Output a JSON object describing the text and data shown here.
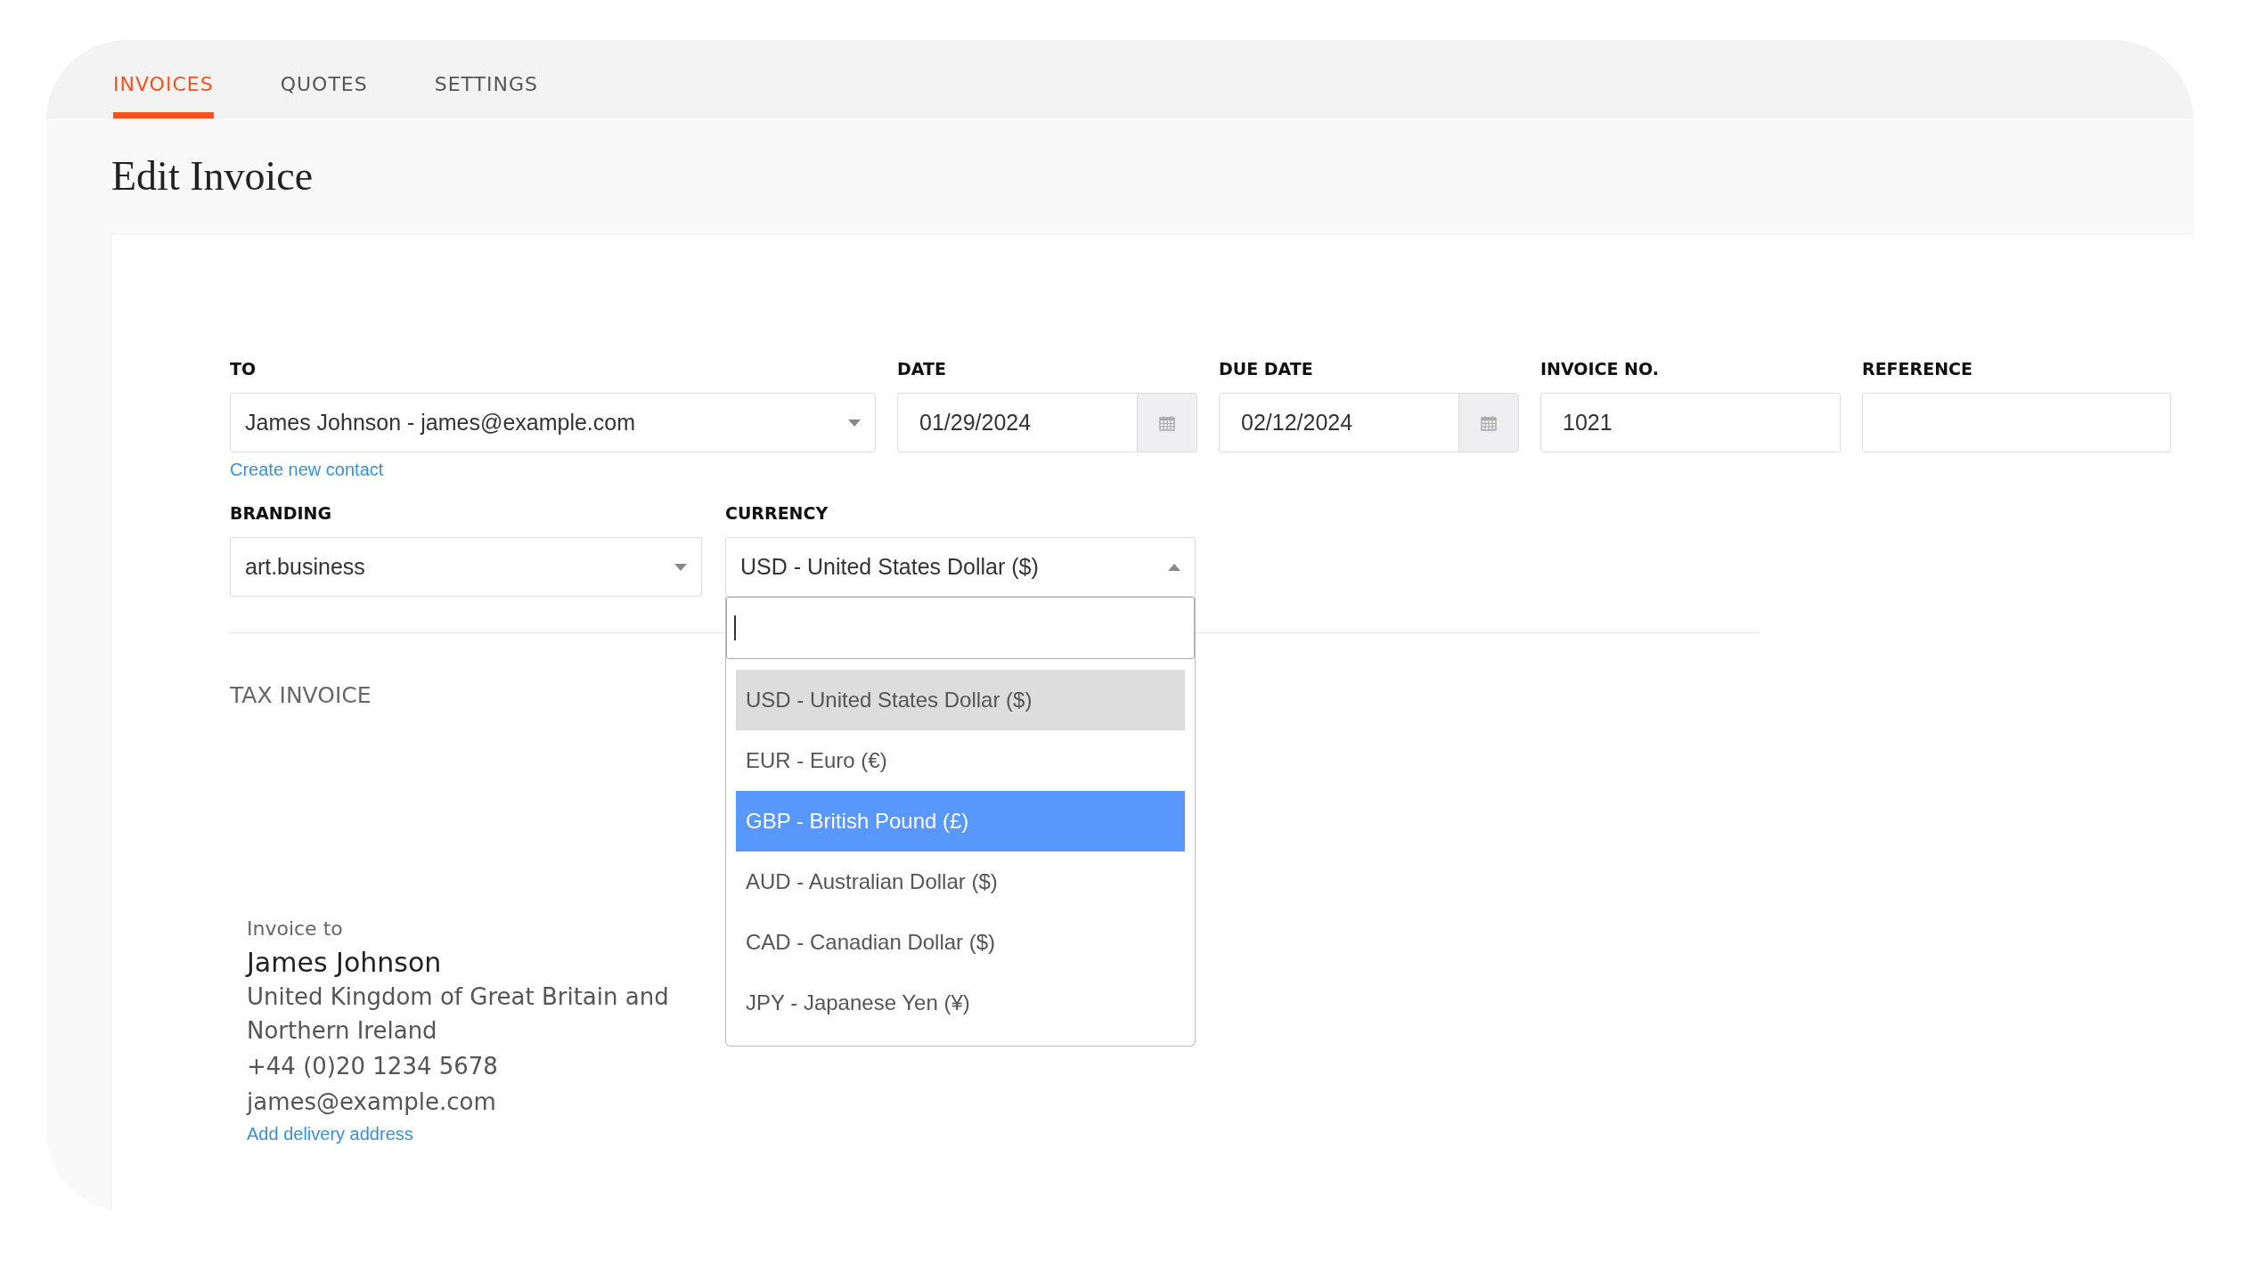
{
  "tabs": [
    {
      "label": "INVOICES",
      "selected": true
    },
    {
      "label": "QUOTES",
      "selected": false
    },
    {
      "label": "SETTINGS",
      "selected": false
    }
  ],
  "page_title": "Edit Invoice",
  "form": {
    "row_1": [
      {
        "kind": "select",
        "label": "TO",
        "value": "James Johnson - james@example.com",
        "link": "Create new contact",
        "expanded": false
      },
      {
        "kind": "date",
        "label": "DATE",
        "value": "01/29/2024"
      },
      {
        "kind": "date",
        "label": "DUE DATE",
        "value": "02/12/2024"
      },
      {
        "kind": "text",
        "label": "INVOICE NO.",
        "value": "1021"
      },
      {
        "kind": "text",
        "label": "REFERENCE"
      }
    ],
    "row_2": [
      {
        "kind": "select",
        "label": "BRANDING",
        "value": "art.business",
        "expanded": false
      },
      {
        "kind": "select",
        "label": "CURRENCY",
        "value": "USD - United States Dollar ($)",
        "expanded": true,
        "options": [
          {
            "label": "USD - United States Dollar ($)",
            "selected": true,
            "highlighted": false
          },
          {
            "label": "EUR - Euro (€)",
            "selected": false,
            "highlighted": false
          },
          {
            "label": "GBP - British Pound (£)",
            "selected": false,
            "highlighted": true
          },
          {
            "label": "AUD - Australian Dollar ($)",
            "selected": false,
            "highlighted": false
          },
          {
            "label": "CAD - Canadian Dollar ($)",
            "selected": false,
            "highlighted": false
          },
          {
            "label": "JPY - Japanese Yen (¥)",
            "selected": false,
            "highlighted": false
          }
        ]
      }
    ]
  },
  "section_title": "TAX INVOICE",
  "invoice_to": {
    "heading": "Invoice to",
    "name": "James Johnson",
    "address": "United Kingdom of Great Britain and Northern Ireland",
    "phone": "+44 (0)20 1234 5678",
    "email": "james@example.com",
    "link": "Add delivery address"
  }
}
